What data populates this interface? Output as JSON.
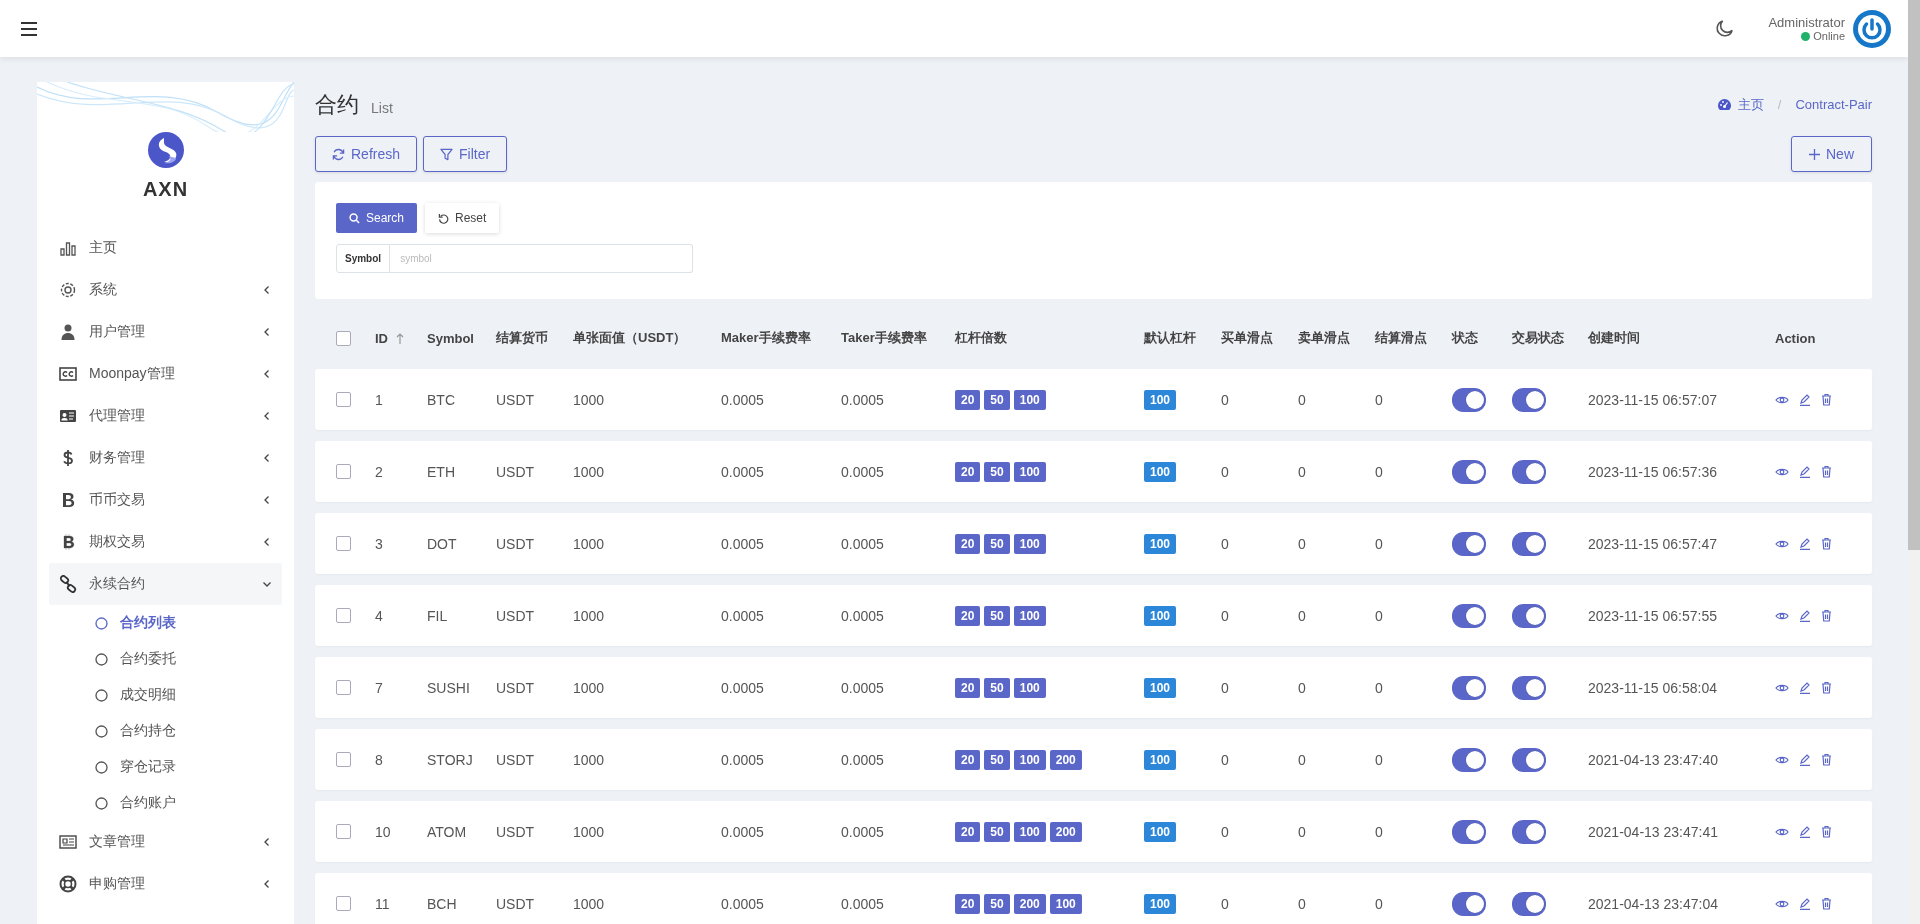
{
  "header": {
    "user": "Administrator",
    "status": "Online"
  },
  "sidebar": {
    "brand": "AXN",
    "items": [
      {
        "label": "主页",
        "kind": "link"
      },
      {
        "label": "系统",
        "kind": "group",
        "expanded": false
      },
      {
        "label": "用户管理",
        "kind": "group",
        "expanded": false
      },
      {
        "label": "Moonpay管理",
        "kind": "group",
        "expanded": false
      },
      {
        "label": "代理管理",
        "kind": "group",
        "expanded": false
      },
      {
        "label": "财务管理",
        "kind": "group",
        "expanded": false
      },
      {
        "label": "币币交易",
        "kind": "group",
        "expanded": false
      },
      {
        "label": "期权交易",
        "kind": "group",
        "expanded": false
      },
      {
        "label": "永续合约",
        "kind": "group",
        "expanded": true,
        "children": [
          {
            "label": "合约列表",
            "selected": true
          },
          {
            "label": "合约委托",
            "selected": false
          },
          {
            "label": "成交明细",
            "selected": false
          },
          {
            "label": "合约持仓",
            "selected": false
          },
          {
            "label": "穿仓记录",
            "selected": false
          },
          {
            "label": "合约账户",
            "selected": false
          }
        ]
      },
      {
        "label": "文章管理",
        "kind": "group",
        "expanded": false
      },
      {
        "label": "申购管理",
        "kind": "group",
        "expanded": false
      }
    ]
  },
  "page": {
    "title": "合约",
    "subtitle": "List",
    "breadcrumb": [
      "主页",
      "Contract-Pair"
    ],
    "breadcrumb_separator": "/",
    "toolbar": [
      "Refresh",
      "Filter"
    ],
    "new_button": "New"
  },
  "search": {
    "buttons": [
      "Search",
      "Reset"
    ],
    "field": {
      "label": "Symbol",
      "placeholder": "symbol"
    }
  },
  "table": {
    "select_all": {
      "checked": false
    },
    "columns": [
      {
        "label": "ID",
        "sort_ascending": true
      },
      {
        "label": "Symbol"
      },
      {
        "label": "结算货币"
      },
      {
        "label": "单张面值（USDT）"
      },
      {
        "label": "Maker手续费率"
      },
      {
        "label": "Taker手续费率"
      },
      {
        "label": "杠杆倍数"
      },
      {
        "label": "默认杠杆"
      },
      {
        "label": "买单滑点"
      },
      {
        "label": "卖单滑点"
      },
      {
        "label": "结算滑点"
      },
      {
        "label": "状态"
      },
      {
        "label": "交易状态"
      },
      {
        "label": "创建时间"
      },
      {
        "label": "Action"
      }
    ],
    "rows": [
      {
        "checked": false,
        "id": "1",
        "symbol": "BTC",
        "currency": "USDT",
        "face_value": "1000",
        "maker_fee": "0.0005",
        "taker_fee": "0.0005",
        "leverage": [
          "20",
          "50",
          "100"
        ],
        "default_leverage": "100",
        "buy_slip": "0",
        "sell_slip": "0",
        "settle_slip": "0",
        "status_on": true,
        "trade_on": true,
        "created": "2023-11-15 06:57:07"
      },
      {
        "checked": false,
        "id": "2",
        "symbol": "ETH",
        "currency": "USDT",
        "face_value": "1000",
        "maker_fee": "0.0005",
        "taker_fee": "0.0005",
        "leverage": [
          "20",
          "50",
          "100"
        ],
        "default_leverage": "100",
        "buy_slip": "0",
        "sell_slip": "0",
        "settle_slip": "0",
        "status_on": true,
        "trade_on": true,
        "created": "2023-11-15 06:57:36"
      },
      {
        "checked": false,
        "id": "3",
        "symbol": "DOT",
        "currency": "USDT",
        "face_value": "1000",
        "maker_fee": "0.0005",
        "taker_fee": "0.0005",
        "leverage": [
          "20",
          "50",
          "100"
        ],
        "default_leverage": "100",
        "buy_slip": "0",
        "sell_slip": "0",
        "settle_slip": "0",
        "status_on": true,
        "trade_on": true,
        "created": "2023-11-15 06:57:47"
      },
      {
        "checked": false,
        "id": "4",
        "symbol": "FIL",
        "currency": "USDT",
        "face_value": "1000",
        "maker_fee": "0.0005",
        "taker_fee": "0.0005",
        "leverage": [
          "20",
          "50",
          "100"
        ],
        "default_leverage": "100",
        "buy_slip": "0",
        "sell_slip": "0",
        "settle_slip": "0",
        "status_on": true,
        "trade_on": true,
        "created": "2023-11-15 06:57:55"
      },
      {
        "checked": false,
        "id": "7",
        "symbol": "SUSHI",
        "currency": "USDT",
        "face_value": "1000",
        "maker_fee": "0.0005",
        "taker_fee": "0.0005",
        "leverage": [
          "20",
          "50",
          "100"
        ],
        "default_leverage": "100",
        "buy_slip": "0",
        "sell_slip": "0",
        "settle_slip": "0",
        "status_on": true,
        "trade_on": true,
        "created": "2023-11-15 06:58:04"
      },
      {
        "checked": false,
        "id": "8",
        "symbol": "STORJ",
        "currency": "USDT",
        "face_value": "1000",
        "maker_fee": "0.0005",
        "taker_fee": "0.0005",
        "leverage": [
          "20",
          "50",
          "100",
          "200"
        ],
        "default_leverage": "100",
        "buy_slip": "0",
        "sell_slip": "0",
        "settle_slip": "0",
        "status_on": true,
        "trade_on": true,
        "created": "2021-04-13 23:47:40"
      },
      {
        "checked": false,
        "id": "10",
        "symbol": "ATOM",
        "currency": "USDT",
        "face_value": "1000",
        "maker_fee": "0.0005",
        "taker_fee": "0.0005",
        "leverage": [
          "20",
          "50",
          "100",
          "200"
        ],
        "default_leverage": "100",
        "buy_slip": "0",
        "sell_slip": "0",
        "settle_slip": "0",
        "status_on": true,
        "trade_on": true,
        "created": "2021-04-13 23:47:41"
      },
      {
        "checked": false,
        "id": "11",
        "symbol": "BCH",
        "currency": "USDT",
        "face_value": "1000",
        "maker_fee": "0.0005",
        "taker_fee": "0.0005",
        "leverage": [
          "20",
          "50",
          "200",
          "100"
        ],
        "default_leverage": "100",
        "buy_slip": "0",
        "sell_slip": "0",
        "settle_slip": "0",
        "status_on": true,
        "trade_on": true,
        "created": "2021-04-13 23:47:04"
      }
    ]
  }
}
